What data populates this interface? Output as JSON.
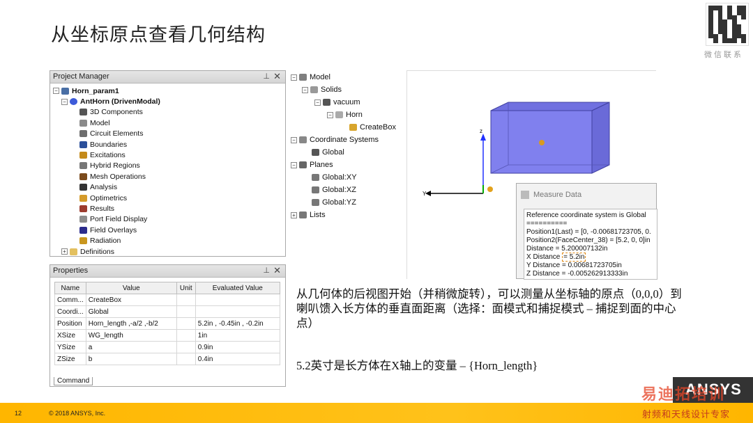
{
  "slide": {
    "title": "从坐标原点查看几何结构",
    "qr_caption": "微信联系",
    "description": "从几何体的后视图开始（并稍微旋转），可以测量从坐标轴的原点（0,0,0）到喇叭馈入长方体的垂直面距离（选择：面模式和捕捉模式 – 捕捉到面的中心点）",
    "note": "5.2英寸是长方体在X轴上的变量 – {Horn_length}"
  },
  "project_manager": {
    "title": "Project Manager",
    "pin": "⊥",
    "close": "✕",
    "items": [
      {
        "label": "Horn_param1"
      },
      {
        "label": "AntHorn (DrivenModal)"
      },
      {
        "label": "3D Components"
      },
      {
        "label": "Model"
      },
      {
        "label": "Circuit Elements"
      },
      {
        "label": "Boundaries"
      },
      {
        "label": "Excitations"
      },
      {
        "label": "Hybrid Regions"
      },
      {
        "label": "Mesh Operations"
      },
      {
        "label": "Analysis"
      },
      {
        "label": "Optimetrics"
      },
      {
        "label": "Results"
      },
      {
        "label": "Port Field Display"
      },
      {
        "label": "Field Overlays"
      },
      {
        "label": "Radiation"
      },
      {
        "label": "Definitions"
      }
    ]
  },
  "properties": {
    "title": "Properties",
    "headers": [
      "Name",
      "Value",
      "Unit",
      "Evaluated Value"
    ],
    "rows": [
      [
        "Comm...",
        "CreateBox",
        "",
        ""
      ],
      [
        "Coordi...",
        "Global",
        "",
        ""
      ],
      [
        "Position",
        "Horn_length ,-a/2 ,-b/2",
        "",
        "5.2in , -0.45in , -0.2in"
      ],
      [
        "XSize",
        "WG_length",
        "",
        "1in"
      ],
      [
        "YSize",
        "a",
        "",
        "0.9in"
      ],
      [
        "ZSize",
        "b",
        "",
        "0.4in"
      ]
    ],
    "tab": "Command"
  },
  "model_tree": {
    "items": [
      {
        "label": "Model"
      },
      {
        "label": "Solids"
      },
      {
        "label": "vacuum"
      },
      {
        "label": "Horn"
      },
      {
        "label": "CreateBox"
      },
      {
        "label": "Coordinate Systems"
      },
      {
        "label": "Global"
      },
      {
        "label": "Planes"
      },
      {
        "label": "Global:XY"
      },
      {
        "label": "Global:XZ"
      },
      {
        "label": "Global:YZ"
      },
      {
        "label": "Lists"
      }
    ]
  },
  "viewport": {
    "axis_z": "z",
    "axis_y": "Y",
    "box_color": "#7b7be8"
  },
  "measure": {
    "title": "Measure Data",
    "lines": [
      "Reference coordinate system is Global",
      "==========",
      "Position1(Last) = [0, -0.00681723705, 0.",
      "Position2(FaceCenter_38) = [5.2, 0, 0]in",
      "Distance = 5.200007132in"
    ],
    "x_prefix": "X Distance ",
    "x_value": "= 5.2in",
    "lines_after": [
      "Y Distance = 0.00681723705in",
      "Z Distance = -0.005262913333in"
    ]
  },
  "footer": {
    "page": "12",
    "copyright": "© 2018 ANSYS, Inc.",
    "brand": "ANSYS",
    "watermark_top": "易迪拓培训",
    "watermark_bottom": "射频和天线设计专家",
    "bar_color": "#ffb600"
  }
}
